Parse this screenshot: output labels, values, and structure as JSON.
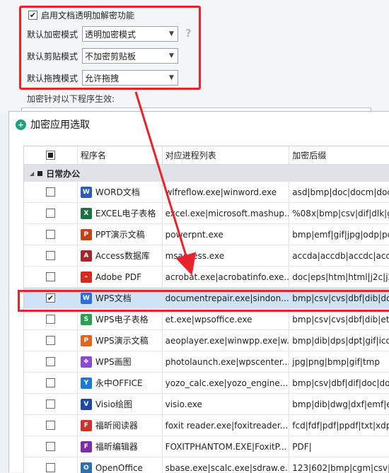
{
  "settings": {
    "enable_label": "启用文档透明加解密功能",
    "enable_checked": "✔",
    "rows": [
      {
        "label": "默认加密模式",
        "value": "透明加密模式"
      },
      {
        "label": "默认剪贴模式",
        "value": "不加密剪贴板"
      },
      {
        "label": "默认拖拽模式",
        "value": "允许拖拽"
      }
    ],
    "help": "?",
    "effect_label": "加密针对以下程序生效:"
  },
  "dialog": {
    "title": "加密应用选取",
    "headers": {
      "col1": "程序名",
      "col2": "对应进程列表",
      "col3": "加密后缀"
    },
    "group": "日常办公",
    "rows": [
      {
        "name": "WORD文档",
        "proc": "wlfreflow.exe|winword.exe",
        "ext": "asd|bmp|doc|docm|doc",
        "checked": "",
        "icon": "W",
        "color": "#2b5fb4"
      },
      {
        "name": "EXCEL电子表格",
        "proc": "excel.exe|microsoft.mashup....",
        "ext": "%08x|bmp|csv|dif|dlk|gif",
        "checked": "",
        "icon": "X",
        "color": "#1d7044"
      },
      {
        "name": "PPT演示文稿",
        "proc": "powerpnt.exe",
        "ext": "bmp|emf|gif|jpg|odp|pd",
        "checked": "",
        "icon": "P",
        "color": "#c4421a"
      },
      {
        "name": "Access数据库",
        "proc": "msaccess.exe",
        "ext": "accda|accdb|accdc|accd",
        "checked": "",
        "icon": "A",
        "color": "#a4262c"
      },
      {
        "name": "Adobe PDF",
        "proc": "acrobat.exe|acrobatinfo.exe...",
        "ext": "doc|eps|htm|html|j2c|j2k",
        "checked": "",
        "icon": "⌁",
        "color": "#d32b1f"
      },
      {
        "name": "WPS文档",
        "proc": "documentrepair.exe|sindon...",
        "ext": "bmp|csv|cvs|dbf|dib|doc",
        "checked": "✔",
        "icon": "W",
        "color": "#2e6fd6"
      },
      {
        "name": "WPS电子表格",
        "proc": "et.exe|wpsoffice.exe",
        "ext": "bmp|csv|cvs|dbf|dib|et|",
        "checked": "",
        "icon": "S",
        "color": "#2f9e4f"
      },
      {
        "name": "WPS演示文稿",
        "proc": "aeoplayer.exe|winwpp.exe|w...",
        "ext": "bmp|dib|dps|dpt|gif|ico|",
        "checked": "",
        "icon": "P",
        "color": "#e0661d"
      },
      {
        "name": "WPS画图",
        "proc": "photolaunch.exe|wpscenter....",
        "ext": "jpg|png|bmp|gif|tmp",
        "checked": "",
        "icon": "❖",
        "color": "#8d4bd0"
      },
      {
        "name": "永中OFFICE",
        "proc": "yozo_calc.exe|yozo_engine....",
        "ext": "bmp|csv|dbf|dif|doc|doc",
        "checked": "",
        "icon": "Y",
        "color": "#1f7ac9"
      },
      {
        "name": "Visio绘图",
        "proc": "visio.exe",
        "ext": "bmp|dib|dwg|dxf|emf|emz",
        "checked": "",
        "icon": "V",
        "color": "#1d4a9e"
      },
      {
        "name": "福昕阅读器",
        "proc": "foxit reader.exe|foxitreader....",
        "ext": "fcd|fdf|pdf|ppdf|txt|xdp|",
        "checked": "",
        "icon": "F",
        "color": "#d0302e"
      },
      {
        "name": "福昕编辑器",
        "proc": "FOXITPHANTOM.EXE|FoxitP...",
        "ext": "PDF|",
        "checked": "",
        "icon": "F",
        "color": "#7a2fa8"
      },
      {
        "name": "OpenOffice",
        "proc": "sbase.exe|scalc.exe|sdraw.e...",
        "ext": "123|602|bmp|cgm|csv|dl",
        "checked": "",
        "icon": "O",
        "color": "#2d6fb0"
      }
    ]
  }
}
